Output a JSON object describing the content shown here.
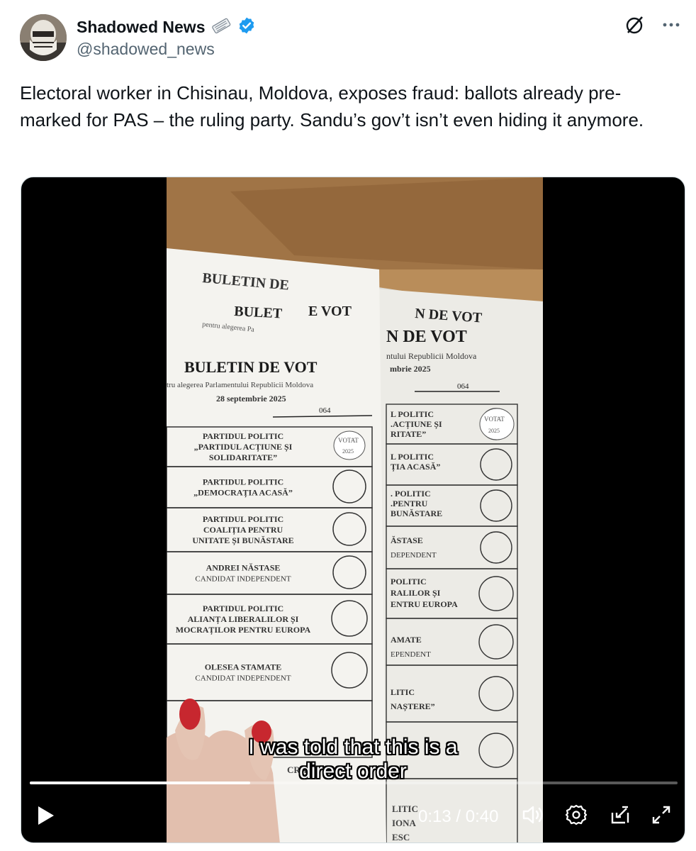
{
  "author": {
    "name": "Shadowed News",
    "handle": "@shadowed_news",
    "verified_color": "#1d9bf0"
  },
  "tweet": {
    "text": "Electoral worker in Chisinau, Moldova, exposes fraud: ballots already pre-marked for PAS – the ruling party. Sandu’s gov’t isn’t even hiding it anymore."
  },
  "video": {
    "subtitle_line1": "I was told that this is a",
    "subtitle_line2": "direct order",
    "current_time": "0:13",
    "separator": "/",
    "duration": "0:40",
    "progress_fraction": 0.34,
    "ballot": {
      "title": "BULETIN DE VOT",
      "subtitle": "tru alegerea Parlamentului Republicii Moldova",
      "date": "28 septembrie 2025",
      "number": "064",
      "stamp": "VOTAT",
      "stamp_year": "2025",
      "rows": [
        {
          "line1": "PARTIDUL POLITIC",
          "line2": "„PARTIDUL ACȚIUNE ȘI",
          "line3": "SOLIDARITATE”"
        },
        {
          "line1": "PARTIDUL POLITIC",
          "line2": "„DEMOCRAȚIA ACASĂ”",
          "line3": ""
        },
        {
          "line1": "PARTIDUL POLITIC",
          "line2": "COALIȚIA PENTRU",
          "line3": "UNITATE ȘI BUNĂSTARE"
        },
        {
          "line1": "ANDREI NĂSTASE",
          "line2": "CANDIDAT INDEPENDENT",
          "line3": ""
        },
        {
          "line1": "PARTIDUL POLITIC",
          "line2": "ALIANȚA LIBERALILOR ȘI",
          "line3": "MOCRAȚILOR PENTRU EUROPA"
        },
        {
          "line1": "OLESEA STAMATE",
          "line2": "CANDIDAT INDEPENDENT",
          "line3": ""
        }
      ]
    }
  },
  "icons": {
    "grok": "grok-icon",
    "more": "more-icon",
    "play": "play-icon",
    "volume": "volume-icon",
    "settings": "gear-icon",
    "pip": "pip-icon",
    "fullscreen": "fullscreen-icon"
  }
}
